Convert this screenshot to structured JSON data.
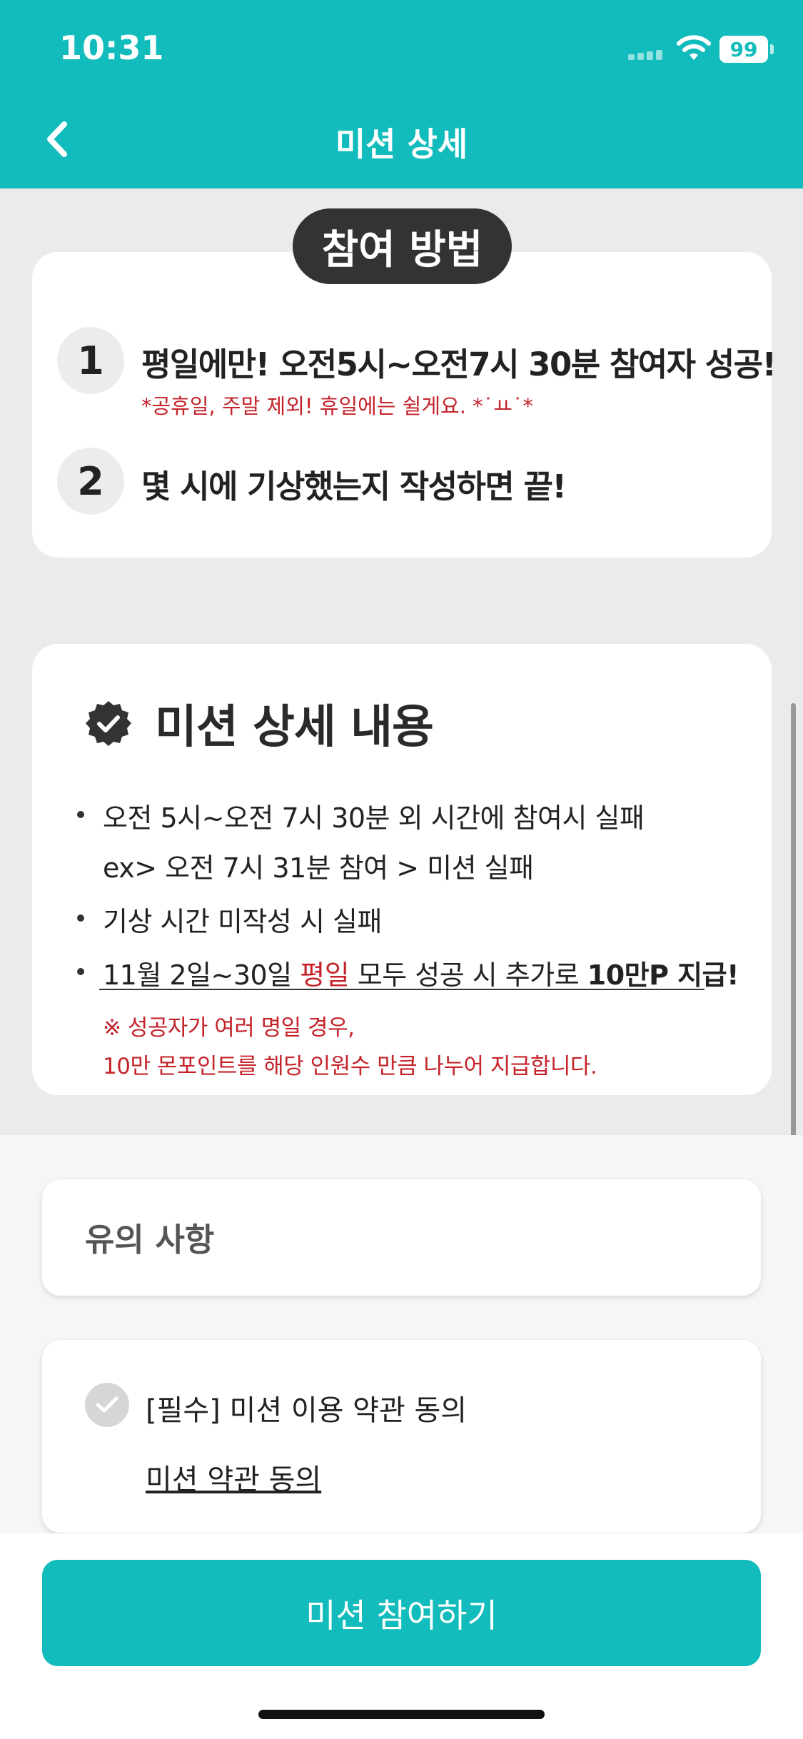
{
  "status_bar": {
    "time": "10:31",
    "battery": "99"
  },
  "nav": {
    "title": "미션 상세"
  },
  "method": {
    "label": "참여 방법",
    "steps": [
      {
        "num": "1",
        "text": "평일에만! 오전5시~오전7시 30분 참여자 성공!",
        "note": "*공휴일, 주말 제외! 휴일에는 쉴게요. *˙ㅛ˙*"
      },
      {
        "num": "2",
        "text": "몇 시에 기상했는지 작성하면 끝!"
      }
    ]
  },
  "details": {
    "title": "미션 상세 내용",
    "bullet1_line1": "오전 5시~오전 7시 30분 외 시간에 참여시 실패",
    "bullet1_line2": "ex> 오전 7시 31분 참여 > 미션 실패",
    "bullet2": "기상 시간 미작성 시 실패",
    "bullet3_part1": "11월 2일~30일 ",
    "bullet3_red": "평일",
    "bullet3_part2": " 모두 성공 시 추가로 ",
    "bullet3_bold": "10만P 지급!",
    "warning_line1": "※ 성공자가 여러 명일 경우,",
    "warning_line2": "10만 몬포인트를 해당 인원수 만큼 나누어 지급합니다."
  },
  "notice": {
    "title": "유의 사항"
  },
  "agreement": {
    "label": "[필수] 미션 이용 약관 동의",
    "link": "미션 약관 동의"
  },
  "cta": {
    "label": "미션 참여하기"
  },
  "colors": {
    "primary": "#12bcbc",
    "warning": "#c4232a",
    "dark": "#333333"
  }
}
